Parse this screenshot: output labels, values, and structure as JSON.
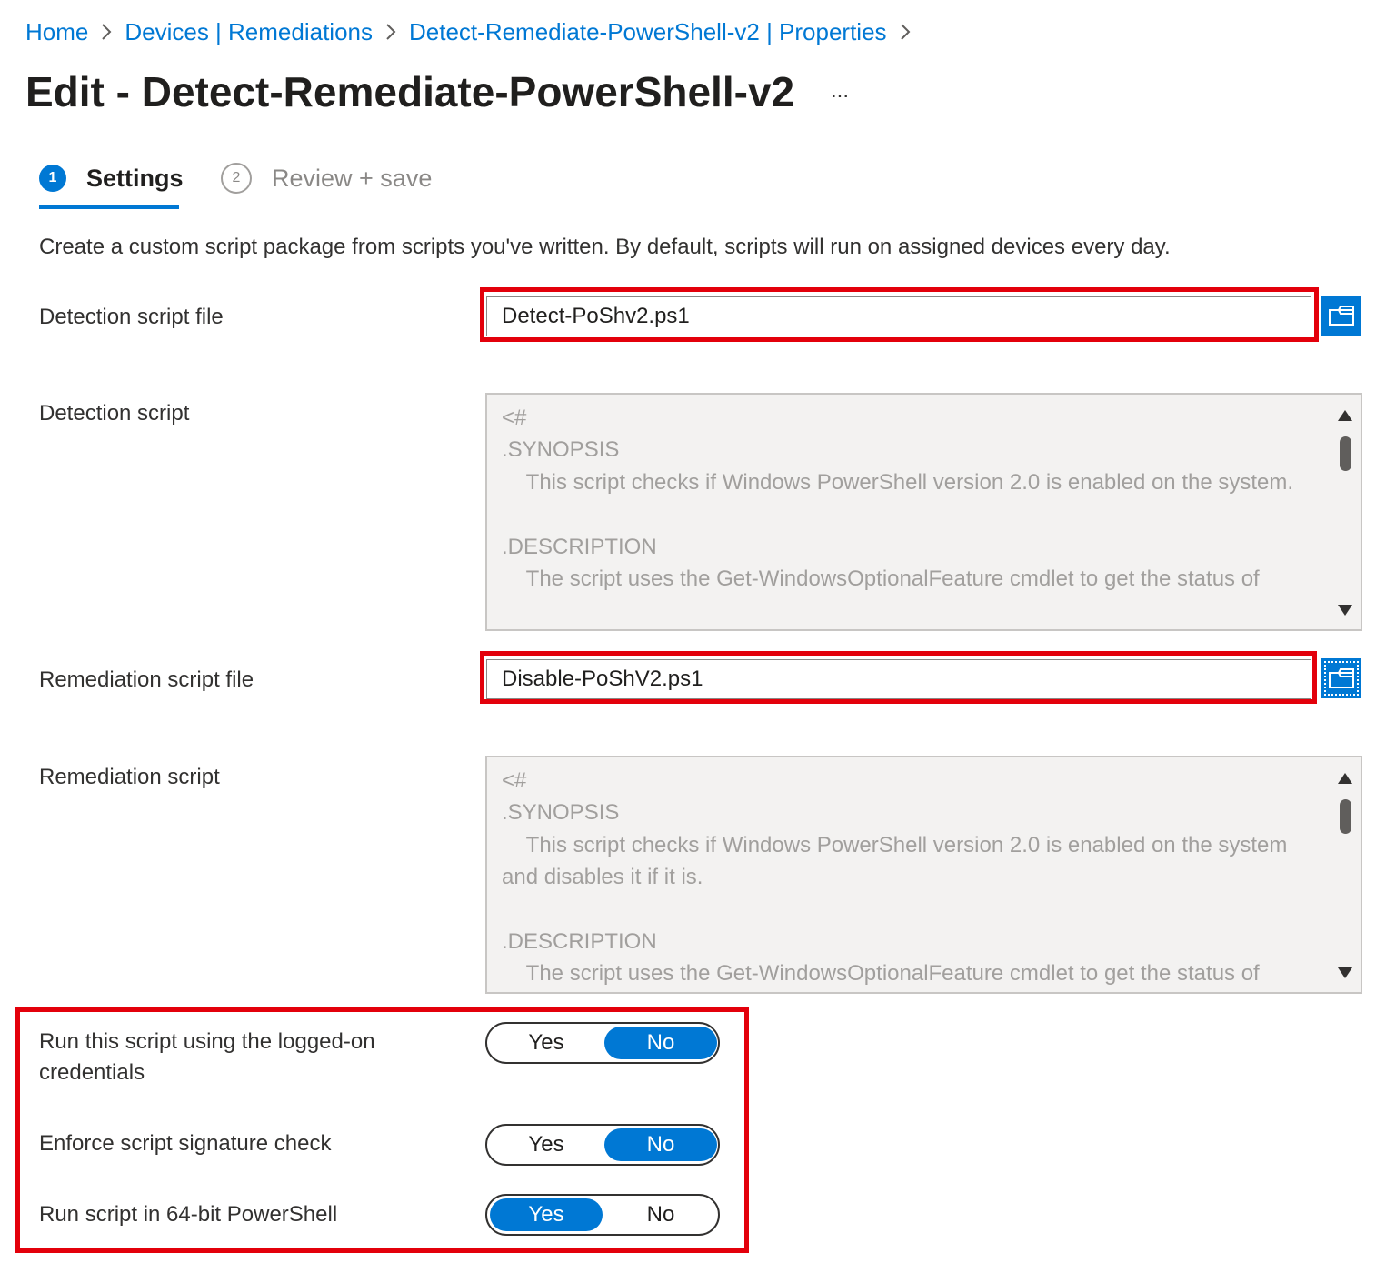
{
  "breadcrumb": {
    "items": [
      "Home",
      "Devices | Remediations",
      "Detect-Remediate-PowerShell-v2 | Properties"
    ]
  },
  "header": {
    "title": "Edit - Detect-Remediate-PowerShell-v2",
    "more_label": "..."
  },
  "wizard": {
    "steps": [
      {
        "number": "1",
        "label": "Settings",
        "active": true
      },
      {
        "number": "2",
        "label": "Review + save",
        "active": false
      }
    ]
  },
  "main": {
    "description": "Create a custom script package from scripts you've written. By default, scripts will run on assigned devices every day.",
    "detection_file": {
      "label": "Detection script file",
      "value": "Detect-PoShv2.ps1"
    },
    "detection_script": {
      "label": "Detection script",
      "content": "<#\n.SYNOPSIS\n    This script checks if Windows PowerShell version 2.0 is enabled on the system.\n\n.DESCRIPTION\n    The script uses the Get-WindowsOptionalFeature cmdlet to get the status of"
    },
    "remediation_file": {
      "label": "Remediation script file",
      "value": "Disable-PoShV2.ps1"
    },
    "remediation_script": {
      "label": "Remediation script",
      "content": "<#\n.SYNOPSIS\n    This script checks if Windows PowerShell version 2.0 is enabled on the system and disables it if it is.\n\n.DESCRIPTION\n    The script uses the Get-WindowsOptionalFeature cmdlet to get the status of"
    },
    "toggles": [
      {
        "label": "Run this script using the logged-on credentials",
        "yes": "Yes",
        "no": "No",
        "selected": "No"
      },
      {
        "label": "Enforce script signature check",
        "yes": "Yes",
        "no": "No",
        "selected": "No"
      },
      {
        "label": "Run script in 64-bit PowerShell",
        "yes": "Yes",
        "no": "No",
        "selected": "Yes"
      }
    ]
  },
  "colors": {
    "accent": "#0078d4",
    "highlight": "#e3000b",
    "script_background": "#f3f2f1"
  },
  "icons": {
    "breadcrumb_separator": "chevron-right-icon",
    "browse": "folder-icon",
    "scroll_up": "triangle-up-icon",
    "scroll_down": "triangle-down-icon"
  }
}
